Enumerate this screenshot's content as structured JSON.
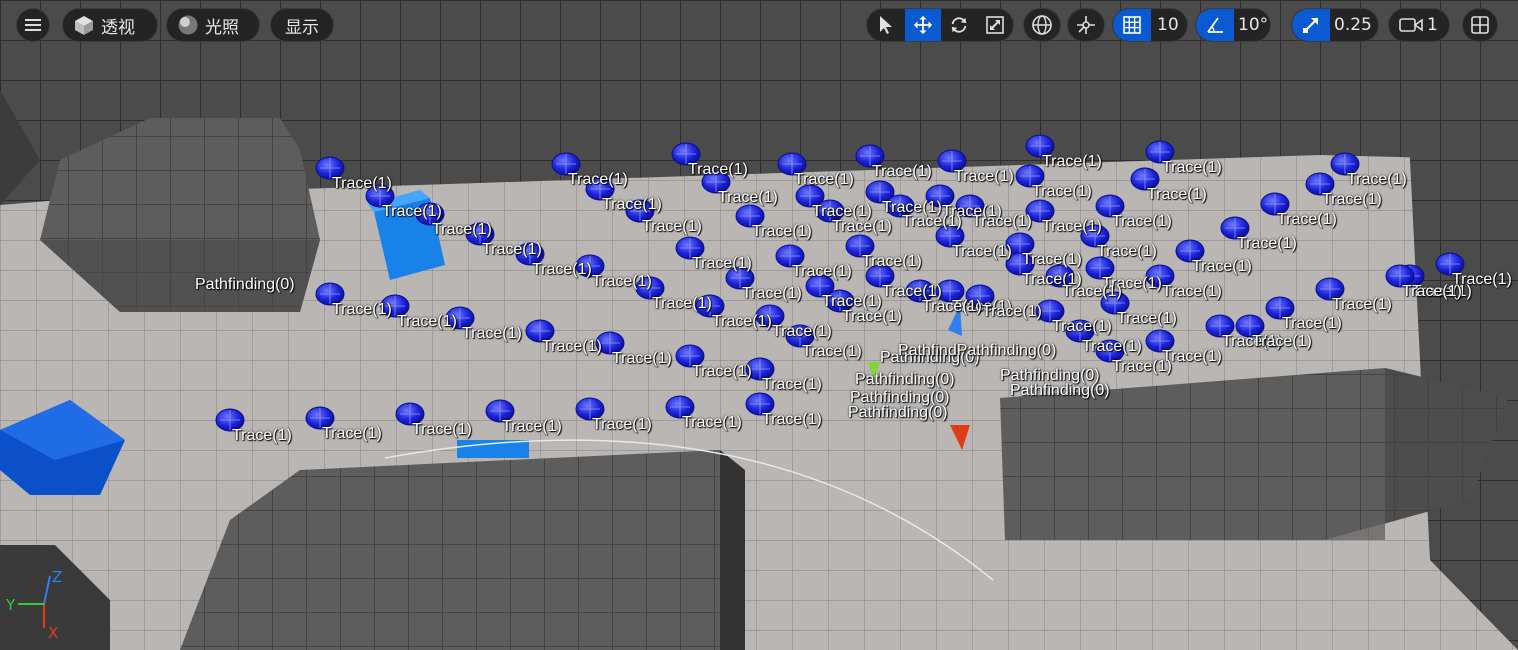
{
  "toolbar": {
    "menu_icon": "hamburger-icon",
    "perspective_label": "透视",
    "lighting_label": "光照",
    "show_label": "显示",
    "grid_snap_value": "10",
    "rotation_snap_value": "10°",
    "scale_snap_value": "0.25",
    "camera_speed_value": "1"
  },
  "scene_labels": {
    "trace": "Trace(1)",
    "pathfinding": "Pathfinding(0)",
    "pathfinding_overlap": "PathfindPathfinding(0)"
  },
  "axis": {
    "x_label": "X",
    "y_label": "Y",
    "z_label": "Z"
  },
  "colors": {
    "accent": "#0a5bd1",
    "marker_blue": "#1a1fd6",
    "cube_blue": "#1671e0",
    "floor": "#b8b4b2",
    "wall": "#5a5a5a"
  }
}
